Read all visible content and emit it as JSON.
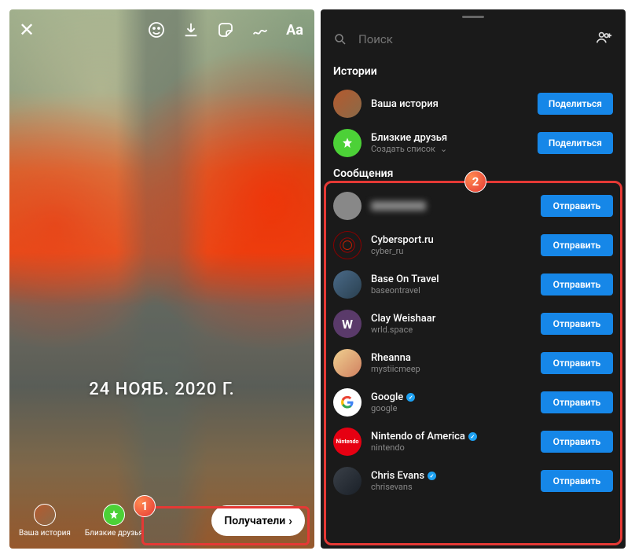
{
  "left": {
    "date_text": "24 НОЯБ. 2020 Г.",
    "targets": [
      {
        "label": "Ваша история"
      },
      {
        "label": "Близкие друзья"
      }
    ],
    "recipients_label": "Получатели",
    "annotation_number": "1"
  },
  "right": {
    "search_placeholder": "Поиск",
    "sections": {
      "stories_title": "Истории",
      "messages_title": "Сообщения"
    },
    "stories": [
      {
        "name": "Ваша история",
        "sub": "",
        "button": "Поделиться",
        "avatar": "story"
      },
      {
        "name": "Близкие друзья",
        "sub": "Создать список",
        "button": "Поделиться",
        "avatar": "green"
      }
    ],
    "messages": [
      {
        "name": "",
        "sub": "",
        "button": "Отправить",
        "avatar": "grey",
        "blurred": true,
        "verified": false
      },
      {
        "name": "Cybersport.ru",
        "sub": "cyber_ru",
        "button": "Отправить",
        "avatar": "cyber",
        "verified": false
      },
      {
        "name": "Base On Travel",
        "sub": "baseontravel",
        "button": "Отправить",
        "avatar": "travel",
        "verified": false
      },
      {
        "name": "Clay Weishaar",
        "sub": "wrld.space",
        "button": "Отправить",
        "avatar": "clay",
        "verified": false
      },
      {
        "name": "Rheanna",
        "sub": "mystiicmeep",
        "button": "Отправить",
        "avatar": "rhea",
        "verified": false
      },
      {
        "name": "Google",
        "sub": "google",
        "button": "Отправить",
        "avatar": "google",
        "verified": true
      },
      {
        "name": "Nintendo of America",
        "sub": "nintendo",
        "button": "Отправить",
        "avatar": "nint",
        "verified": true
      },
      {
        "name": "Chris Evans",
        "sub": "chrisevans",
        "button": "Отправить",
        "avatar": "chris",
        "verified": true
      }
    ],
    "annotation_number": "2"
  }
}
